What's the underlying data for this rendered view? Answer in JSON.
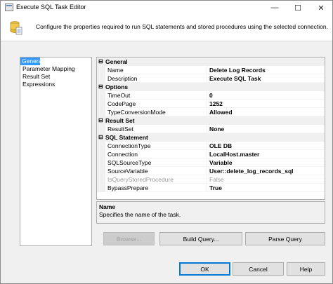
{
  "window": {
    "title": "Execute SQL Task Editor"
  },
  "title_buttons": {
    "minimize": "—",
    "maximize": "☐",
    "close": "✕"
  },
  "header": {
    "text": "Configure the properties required to run SQL statements and stored procedures using the selected connection."
  },
  "nav": {
    "items": [
      "General",
      "Parameter Mapping",
      "Result Set",
      "Expressions"
    ],
    "selected": "General"
  },
  "grid": {
    "collapse_glyph": "⊟",
    "categories": {
      "general": "General",
      "options": "Options",
      "result_set": "Result Set",
      "sql_statement": "SQL Statement"
    },
    "props": {
      "name": {
        "name": "Name",
        "value": "Delete Log Records"
      },
      "description": {
        "name": "Description",
        "value": "Execute SQL Task"
      },
      "timeout": {
        "name": "TimeOut",
        "value": "0"
      },
      "codepage": {
        "name": "CodePage",
        "value": "1252"
      },
      "typeconv": {
        "name": "TypeConversionMode",
        "value": "Allowed"
      },
      "resultset": {
        "name": "ResultSet",
        "value": "None"
      },
      "conntype": {
        "name": "ConnectionType",
        "value": "OLE DB"
      },
      "connection": {
        "name": "Connection",
        "value": "LocalHost.master"
      },
      "sqlsourcetype": {
        "name": "SQLSourceType",
        "value": "Variable"
      },
      "sourcevariable": {
        "name": "SourceVariable",
        "value": "User::delete_log_records_sql"
      },
      "isquerysp": {
        "name": "IsQueryStoredProcedure",
        "value": "False"
      },
      "bypassprepare": {
        "name": "BypassPrepare",
        "value": "True"
      }
    }
  },
  "description_panel": {
    "title": "Name",
    "text": "Specifies the name of the task."
  },
  "buttons": {
    "browse": "Browse...",
    "build_query": "Build Query...",
    "parse_query": "Parse Query",
    "ok": "OK",
    "cancel": "Cancel",
    "help": "Help"
  },
  "colors": {
    "selection": "#3399ff",
    "category_bg": "#f0f0f0",
    "disabled_text": "#9a9a9a"
  }
}
